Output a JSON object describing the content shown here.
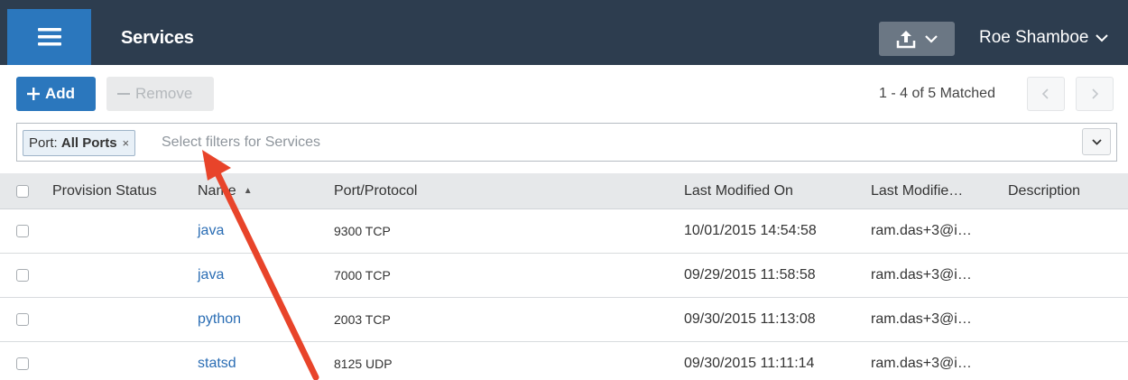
{
  "header": {
    "title": "Services",
    "user_name": "Roe Shamboe",
    "icons": {
      "menu": "hamburger-icon",
      "export": "upload-icon",
      "user_caret": "chevron-down-icon"
    }
  },
  "toolbar": {
    "add_label": "Add",
    "remove_label": "Remove",
    "match_text": "1 - 4 of 5 Matched"
  },
  "filter": {
    "chip_key": "Port:",
    "chip_value": "All Ports",
    "chip_close": "×",
    "placeholder": "Select filters for Services"
  },
  "table": {
    "columns": {
      "status": "Provision Status",
      "name": "Name",
      "port": "Port/Protocol",
      "modified_on": "Last Modified On",
      "modified_by": "Last Modifie…",
      "description": "Description"
    },
    "sort": {
      "column": "name",
      "direction": "ascending"
    },
    "rows": [
      {
        "name": "java",
        "port": "9300 TCP",
        "modified_on": "10/01/2015 14:54:58",
        "modified_by": "ram.das+3@i…",
        "status": "",
        "description": ""
      },
      {
        "name": "java",
        "port": "7000 TCP",
        "modified_on": "09/29/2015 11:58:58",
        "modified_by": "ram.das+3@i…",
        "status": "",
        "description": ""
      },
      {
        "name": "python",
        "port": "2003 TCP",
        "modified_on": "09/30/2015 11:13:08",
        "modified_by": "ram.das+3@i…",
        "status": "",
        "description": ""
      },
      {
        "name": "statsd",
        "port": "8125 UDP",
        "modified_on": "09/30/2015 11:11:14",
        "modified_by": "ram.das+3@i…",
        "status": "",
        "description": ""
      }
    ]
  },
  "colors": {
    "topbar": "#2d3d4f",
    "primary": "#2b77bd",
    "link": "#2a6db4",
    "annotation_arrow": "#e8442a"
  }
}
